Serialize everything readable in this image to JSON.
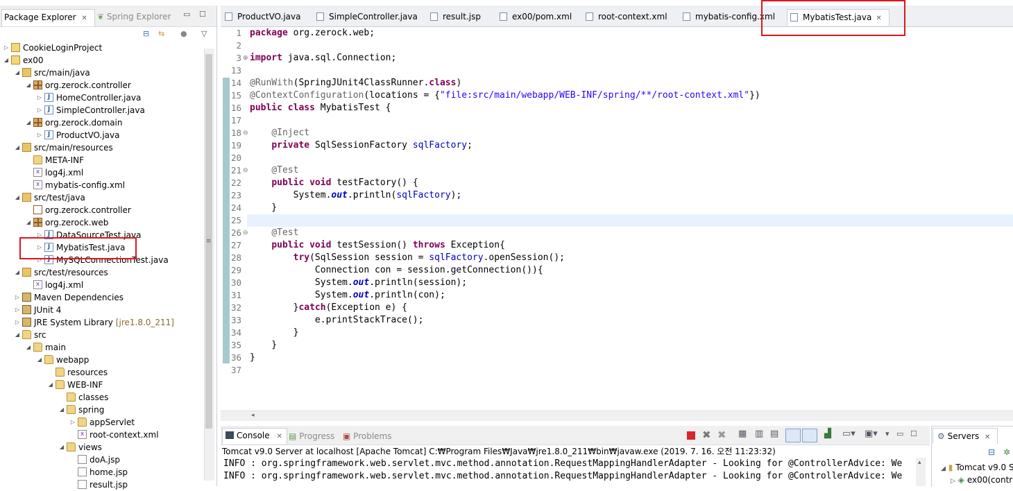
{
  "package_explorer": {
    "tab_label": "Package Explorer",
    "second_tab_label": "Spring Explorer",
    "tree": [
      {
        "label": "CookieLoginProject",
        "depth": 0,
        "icon": "project-icon",
        "expander": "▷"
      },
      {
        "label": "ex00",
        "depth": 0,
        "icon": "maven-project-icon",
        "expander": "◢"
      },
      {
        "label": "src/main/java",
        "depth": 1,
        "icon": "source-folder-icon",
        "expander": "◢"
      },
      {
        "label": "org.zerock.controller",
        "depth": 2,
        "icon": "package-icon",
        "expander": "◢"
      },
      {
        "label": "HomeController.java",
        "depth": 3,
        "icon": "java-file-icon",
        "expander": "▷"
      },
      {
        "label": "SimpleController.java",
        "depth": 3,
        "icon": "java-file-icon",
        "expander": "▷"
      },
      {
        "label": "org.zerock.domain",
        "depth": 2,
        "icon": "package-icon",
        "expander": "◢"
      },
      {
        "label": "ProductVO.java",
        "depth": 3,
        "icon": "java-file-icon",
        "expander": "▷"
      },
      {
        "label": "src/main/resources",
        "depth": 1,
        "icon": "source-folder-icon",
        "expander": "◢"
      },
      {
        "label": "META-INF",
        "depth": 2,
        "icon": "folder-icon",
        "expander": ""
      },
      {
        "label": "log4j.xml",
        "depth": 2,
        "icon": "xml-file-icon",
        "expander": ""
      },
      {
        "label": "mybatis-config.xml",
        "depth": 2,
        "icon": "xml-file-icon",
        "expander": ""
      },
      {
        "label": "src/test/java",
        "depth": 1,
        "icon": "source-folder-icon",
        "expander": "◢"
      },
      {
        "label": "org.zerock.controller",
        "depth": 2,
        "icon": "empty-package-icon",
        "expander": ""
      },
      {
        "label": "org.zerock.web",
        "depth": 2,
        "icon": "package-icon",
        "expander": "◢"
      },
      {
        "label": "DataSourceTest.java",
        "depth": 3,
        "icon": "java-file-icon",
        "expander": "▷"
      },
      {
        "label": "MybatisTest.java",
        "depth": 3,
        "icon": "java-file-icon",
        "expander": "▷"
      },
      {
        "label": "MySQLConnectionTest.java",
        "depth": 3,
        "icon": "java-file-icon",
        "expander": "▷"
      },
      {
        "label": "src/test/resources",
        "depth": 1,
        "icon": "source-folder-icon",
        "expander": "◢"
      },
      {
        "label": "log4j.xml",
        "depth": 2,
        "icon": "xml-file-icon",
        "expander": ""
      },
      {
        "label": "Maven Dependencies",
        "depth": 1,
        "icon": "library-icon",
        "expander": "▷"
      },
      {
        "label": "JUnit 4",
        "depth": 1,
        "icon": "library-icon",
        "expander": "▷"
      },
      {
        "label": "JRE System Library",
        "depth": 1,
        "icon": "library-icon",
        "expander": "▷",
        "decoration": "[jre1.8.0_211]"
      },
      {
        "label": "src",
        "depth": 1,
        "icon": "folder-icon",
        "expander": "◢"
      },
      {
        "label": "main",
        "depth": 2,
        "icon": "folder-icon",
        "expander": "◢"
      },
      {
        "label": "webapp",
        "depth": 3,
        "icon": "folder-icon",
        "expander": "◢"
      },
      {
        "label": "resources",
        "depth": 4,
        "icon": "folder-icon",
        "expander": ""
      },
      {
        "label": "WEB-INF",
        "depth": 4,
        "icon": "folder-icon",
        "expander": "◢"
      },
      {
        "label": "classes",
        "depth": 5,
        "icon": "folder-icon",
        "expander": ""
      },
      {
        "label": "spring",
        "depth": 5,
        "icon": "folder-icon",
        "expander": "◢"
      },
      {
        "label": "appServlet",
        "depth": 6,
        "icon": "folder-icon",
        "expander": "▷"
      },
      {
        "label": "root-context.xml",
        "depth": 6,
        "icon": "xml-file-icon",
        "expander": ""
      },
      {
        "label": "views",
        "depth": 5,
        "icon": "folder-icon",
        "expander": "◢"
      },
      {
        "label": "doA.jsp",
        "depth": 6,
        "icon": "jsp-file-icon",
        "expander": ""
      },
      {
        "label": "home.jsp",
        "depth": 6,
        "icon": "jsp-file-icon",
        "expander": ""
      },
      {
        "label": "result.jsp",
        "depth": 6,
        "icon": "jsp-file-icon",
        "expander": ""
      }
    ]
  },
  "editor": {
    "tabs": [
      {
        "label": "ProductVO.java",
        "active": false
      },
      {
        "label": "SimpleController.java",
        "active": false
      },
      {
        "label": "result.jsp",
        "active": false
      },
      {
        "label": "ex00/pom.xml",
        "active": false
      },
      {
        "label": "root-context.xml",
        "active": false
      },
      {
        "label": "mybatis-config.xml",
        "active": false
      },
      {
        "label": "MybatisTest.java",
        "active": true
      }
    ],
    "line_numbers": [
      "1",
      "2",
      "3",
      "13",
      "14",
      "15",
      "16",
      "17",
      "18",
      "19",
      "20",
      "21",
      "22",
      "23",
      "24",
      "25",
      "26",
      "27",
      "28",
      "29",
      "30",
      "31",
      "32",
      "33",
      "34",
      "35",
      "36",
      "37"
    ],
    "fold_markers": {
      "3": "⊕",
      "18": "⊖",
      "21": "⊖",
      "26": "⊖"
    }
  },
  "console": {
    "tab_label": "Console",
    "progress_label": "Progress",
    "problems_label": "Problems",
    "status": "Tomcat v9.0 Server at localhost [Apache Tomcat] C:₩Program Files₩Java₩jre1.8.0_211₩bin₩javaw.exe (2019. 7. 16. 오전 11:23:32)",
    "lines": [
      "INFO : org.springframework.web.servlet.mvc.method.annotation.RequestMappingHandlerAdapter - Looking for @ControllerAdvice: We",
      "INFO : org.springframework.web.servlet.mvc.method.annotation.RequestMappingHandlerAdapter - Looking for @ControllerAdvice: We"
    ]
  },
  "servers": {
    "tab_label": "Servers",
    "items": [
      "Tomcat v9.0 S",
      "ex00(contr"
    ]
  },
  "colors": {
    "keyword": "#7f0055",
    "annotation": "#646464",
    "string": "#2a00ff",
    "field": "#0000c0",
    "highlight": "#e0141e"
  }
}
